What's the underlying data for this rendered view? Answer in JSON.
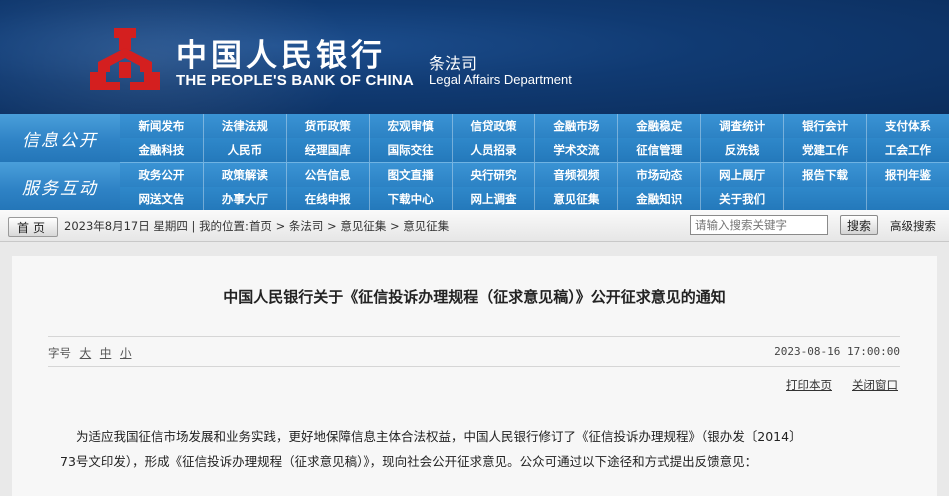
{
  "header": {
    "bank_cn": "中国人民银行",
    "bank_en": "THE PEOPLE'S BANK OF CHINA",
    "dept_cn": "条法司",
    "dept_en": "Legal Affairs Department",
    "colors": {
      "background": "#103a72",
      "logo": "#d41f1f"
    }
  },
  "nav": {
    "section1": "信息公开",
    "section2": "服务互动",
    "rows": [
      [
        "新闻发布",
        "法律法规",
        "货币政策",
        "宏观审慎",
        "信贷政策",
        "金融市场",
        "金融稳定",
        "调查统计",
        "银行会计",
        "支付体系"
      ],
      [
        "金融科技",
        "人民币",
        "经理国库",
        "国际交往",
        "人员招录",
        "学术交流",
        "征信管理",
        "反洗钱",
        "党建工作",
        "工会工作"
      ],
      [
        "政务公开",
        "政策解读",
        "公告信息",
        "图文直播",
        "央行研究",
        "音频视频",
        "市场动态",
        "网上展厅",
        "报告下载",
        "报刊年鉴"
      ],
      [
        "网送文告",
        "办事大厅",
        "在线申报",
        "下载中心",
        "网上调查",
        "意见征集",
        "金融知识",
        "关于我们",
        "",
        ""
      ]
    ]
  },
  "crumbbar": {
    "home_label": "首页",
    "date_text": "2023年8月17日 星期四",
    "location_prefix": "我的位置:",
    "crumbs": [
      "首页",
      "条法司",
      "意见征集",
      "意见征集"
    ],
    "search_placeholder": "请输入搜索关键字",
    "search_button": "搜索",
    "advanced_search": "高级搜索"
  },
  "article": {
    "title": "中国人民银行关于《征信投诉办理规程（征求意见稿）》公开征求意见的通知",
    "fontsize_label": "字号",
    "sizes": [
      "大",
      "中",
      "小"
    ],
    "publish_time": "2023-08-16 17:00:00",
    "print_label": "打印本页",
    "close_label": "关闭窗口",
    "body_line1": "为适应我国征信市场发展和业务实践，更好地保障信息主体合法权益，中国人民银行修订了《征信投诉办理规程》（银办发〔2014〕",
    "body_line2": "73号文印发），形成《征信投诉办理规程（征求意见稿）》，现向社会公开征求意见。公众可通过以下途径和方式提出反馈意见："
  }
}
